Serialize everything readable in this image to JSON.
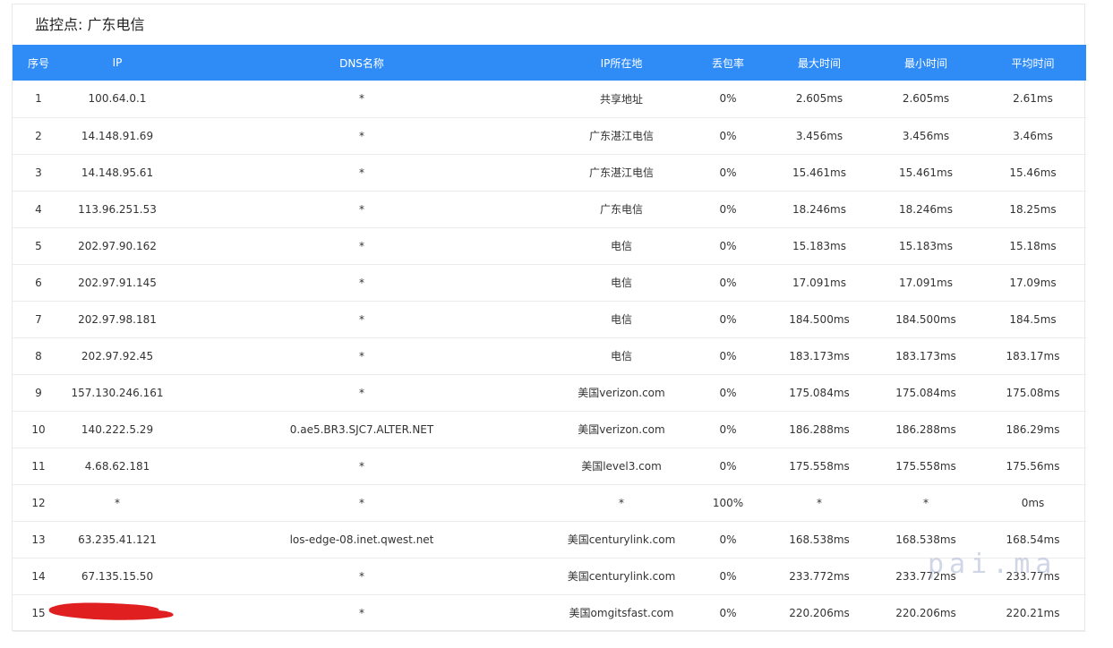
{
  "panel": {
    "title": "监控点: 广东电信"
  },
  "colors": {
    "header_bg": "#2f8cf7",
    "header_text": "#ffffff",
    "redaction": "#e02020",
    "watermark": "#96a5c8"
  },
  "table": {
    "headers": [
      "序号",
      "IP",
      "DNS名称",
      "IP所在地",
      "丢包率",
      "最大时间",
      "最小时间",
      "平均时间"
    ],
    "rows": [
      [
        "1",
        "100.64.0.1",
        "*",
        "共享地址",
        "0%",
        "2.605ms",
        "2.605ms",
        "2.61ms"
      ],
      [
        "2",
        "14.148.91.69",
        "*",
        "广东湛江电信",
        "0%",
        "3.456ms",
        "3.456ms",
        "3.46ms"
      ],
      [
        "3",
        "14.148.95.61",
        "*",
        "广东湛江电信",
        "0%",
        "15.461ms",
        "15.461ms",
        "15.46ms"
      ],
      [
        "4",
        "113.96.251.53",
        "*",
        "广东电信",
        "0%",
        "18.246ms",
        "18.246ms",
        "18.25ms"
      ],
      [
        "5",
        "202.97.90.162",
        "*",
        "电信",
        "0%",
        "15.183ms",
        "15.183ms",
        "15.18ms"
      ],
      [
        "6",
        "202.97.91.145",
        "*",
        "电信",
        "0%",
        "17.091ms",
        "17.091ms",
        "17.09ms"
      ],
      [
        "7",
        "202.97.98.181",
        "*",
        "电信",
        "0%",
        "184.500ms",
        "184.500ms",
        "184.5ms"
      ],
      [
        "8",
        "202.97.92.45",
        "*",
        "电信",
        "0%",
        "183.173ms",
        "183.173ms",
        "183.17ms"
      ],
      [
        "9",
        "157.130.246.161",
        "*",
        "美国verizon.com",
        "0%",
        "175.084ms",
        "175.084ms",
        "175.08ms"
      ],
      [
        "10",
        "140.222.5.29",
        "0.ae5.BR3.SJC7.ALTER.NET",
        "美国verizon.com",
        "0%",
        "186.288ms",
        "186.288ms",
        "186.29ms"
      ],
      [
        "11",
        "4.68.62.181",
        "*",
        "美国level3.com",
        "0%",
        "175.558ms",
        "175.558ms",
        "175.56ms"
      ],
      [
        "12",
        "*",
        "*",
        "*",
        "100%",
        "*",
        "*",
        "0ms"
      ],
      [
        "13",
        "63.235.41.121",
        "los-edge-08.inet.qwest.net",
        "美国centurylink.com",
        "0%",
        "168.538ms",
        "168.538ms",
        "168.54ms"
      ],
      [
        "14",
        "67.135.15.50",
        "*",
        "美国centurylink.com",
        "0%",
        "233.772ms",
        "233.772ms",
        "233.77ms"
      ],
      [
        "15",
        "",
        "*",
        "美国omgitsfast.com",
        "0%",
        "220.206ms",
        "220.206ms",
        "220.21ms"
      ]
    ]
  },
  "watermark": {
    "text": "pai.ma"
  }
}
